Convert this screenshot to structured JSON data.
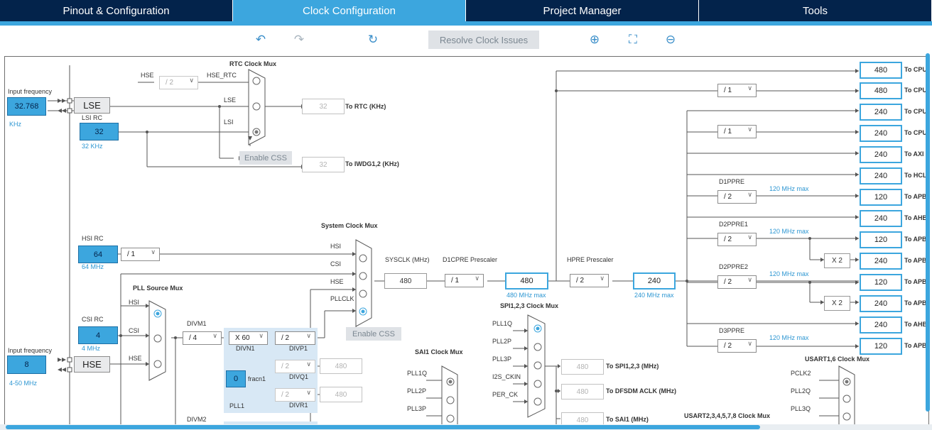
{
  "tabs": [
    {
      "label": "Pinout & Configuration",
      "active": false
    },
    {
      "label": "Clock Configuration",
      "active": true
    },
    {
      "label": "Project Manager",
      "active": false
    },
    {
      "label": "Tools",
      "active": false
    }
  ],
  "toolbar": {
    "undo_icon": "undo-icon",
    "redo_icon": "redo-icon",
    "reset_icon": "refresh-icon",
    "resolve_label": "Resolve Clock Issues",
    "zoom_in_icon": "zoom-in-icon",
    "fit_icon": "fit-screen-icon",
    "zoom_out_icon": "zoom-out-icon"
  },
  "colors": {
    "nav": "#03234b",
    "accent": "#3ca6de"
  },
  "lse": {
    "input_label": "Input frequency",
    "value": "32.768",
    "unit": "KHz",
    "label": "LSE"
  },
  "lsi": {
    "title": "LSI RC",
    "value": "32",
    "unit": "32 KHz"
  },
  "rtc": {
    "title": "RTC Clock Mux",
    "hse_label": "HSE",
    "hse_div": "/ 2",
    "hse_rtc": "HSE_RTC",
    "lse_in": "LSE",
    "lsi_in": "LSI",
    "out_value": "32",
    "out_label": "To RTC (KHz)",
    "enable_css": "Enable CSS",
    "iwdg_value": "32",
    "iwdg_label": "To IWDG1,2 (KHz)"
  },
  "hsi": {
    "title": "HSI RC",
    "value": "64",
    "unit": "64 MHz",
    "div": "/ 1"
  },
  "csi": {
    "title": "CSI RC",
    "value": "4",
    "unit": "4 MHz"
  },
  "hse": {
    "input_label": "Input frequency",
    "value": "8",
    "range": "4-50 MHz",
    "label": "HSE"
  },
  "pll_src": {
    "title": "PLL Source Mux",
    "hsi": "HSI",
    "csi": "CSI",
    "hse": "HSE"
  },
  "pll1": {
    "divm_label": "DIVM1",
    "divm": "/ 4",
    "divn": "X 60",
    "divn_label": "DIVN1",
    "divp": "/ 2",
    "divp_label": "DIVP1",
    "divq": "/ 2",
    "divq_label": "DIVQ1",
    "divq_out": "480",
    "divr": "/ 2",
    "divr_label": "DIVR1",
    "divr_out": "480",
    "fracn": "0",
    "fracn_label": "fracn1",
    "name": "PLL1",
    "divm2_label": "DIVM2"
  },
  "sysmux": {
    "title": "System Clock Mux",
    "hsi": "HSI",
    "csi": "CSI",
    "hse": "HSE",
    "pllclk": "PLLCLK",
    "enable_css": "Enable CSS"
  },
  "sysclk": {
    "label": "SYSCLK (MHz)",
    "value": "480"
  },
  "d1cpre": {
    "label": "D1CPRE Prescaler",
    "value": "/ 1"
  },
  "cpu_clk": {
    "value": "480",
    "max": "480 MHz max"
  },
  "hpre": {
    "label": "HPRE Prescaler",
    "value": "/ 2"
  },
  "hclk": {
    "value": "240",
    "max": "240 MHz max"
  },
  "outputs": [
    {
      "value": "480",
      "label": "To CPU"
    },
    {
      "value": "480",
      "label": "To CPU"
    },
    {
      "value": "240",
      "label": "To CPU"
    },
    {
      "value": "240",
      "label": "To CPU"
    },
    {
      "value": "240",
      "label": "To AXI"
    },
    {
      "value": "240",
      "label": "To HCL"
    },
    {
      "value": "120",
      "label": "To APB"
    },
    {
      "value": "240",
      "label": "To AHB"
    },
    {
      "value": "120",
      "label": "To APB"
    },
    {
      "value": "240",
      "label": "To APB"
    },
    {
      "value": "120",
      "label": "To APB"
    },
    {
      "value": "240",
      "label": "To APB"
    },
    {
      "value": "240",
      "label": "To AHB"
    },
    {
      "value": "120",
      "label": "To APB"
    }
  ],
  "right_div1": "/ 1",
  "right_div2": "/ 1",
  "d1ppre": {
    "label": "D1PPRE",
    "value": "/ 2",
    "max": "120 MHz max"
  },
  "d2ppre1": {
    "label": "D2PPRE1",
    "value": "/ 2",
    "max": "120 MHz max",
    "mul": "X 2"
  },
  "d2ppre2": {
    "label": "D2PPRE2",
    "value": "/ 2",
    "max": "120 MHz max",
    "mul": "X 2"
  },
  "d3ppre": {
    "label": "D3PPRE",
    "value": "/ 2",
    "max": "120 MHz max"
  },
  "spi123": {
    "title": "SPI1,2,3 Clock Mux",
    "in1": "PLL1Q",
    "in2": "PLL2P",
    "in3": "PLL3P",
    "in4": "I2S_CKIN",
    "in5": "PER_CK",
    "out1_value": "480",
    "out1_label": "To SPI1,2,3 (MHz)",
    "out2_value": "480",
    "out2_label": "To DFSDM ACLK (MHz)",
    "out3_value": "480",
    "out3_label": "To SAI1 (MHz)"
  },
  "sai1": {
    "title": "SAI1 Clock Mux",
    "in1": "PLL1Q",
    "in2": "PLL2P",
    "in3": "PLL3P"
  },
  "usart16": {
    "title": "USART1,6 Clock Mux",
    "in1": "PCLK2",
    "in2": "PLL2Q",
    "in3": "PLL3Q"
  },
  "usart2": {
    "title": "USART2,3,4,5,7,8 Clock Mux"
  }
}
